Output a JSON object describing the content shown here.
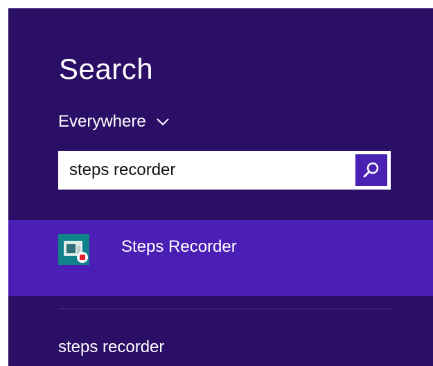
{
  "search": {
    "title": "Search",
    "scope_label": "Everywhere",
    "query": "steps recorder"
  },
  "icons": {
    "scope_dropdown": "chevron-down-icon",
    "search_button": "search-icon",
    "app": "steps-recorder-app-icon"
  },
  "results": [
    {
      "label": "Steps Recorder"
    }
  ],
  "suggestions": [
    {
      "label": "steps recorder"
    }
  ],
  "colors": {
    "panel_background": "#2b0f67",
    "result_highlight": "#4b1fb5",
    "search_button": "#4a22b3",
    "app_tile": "#10838a"
  }
}
